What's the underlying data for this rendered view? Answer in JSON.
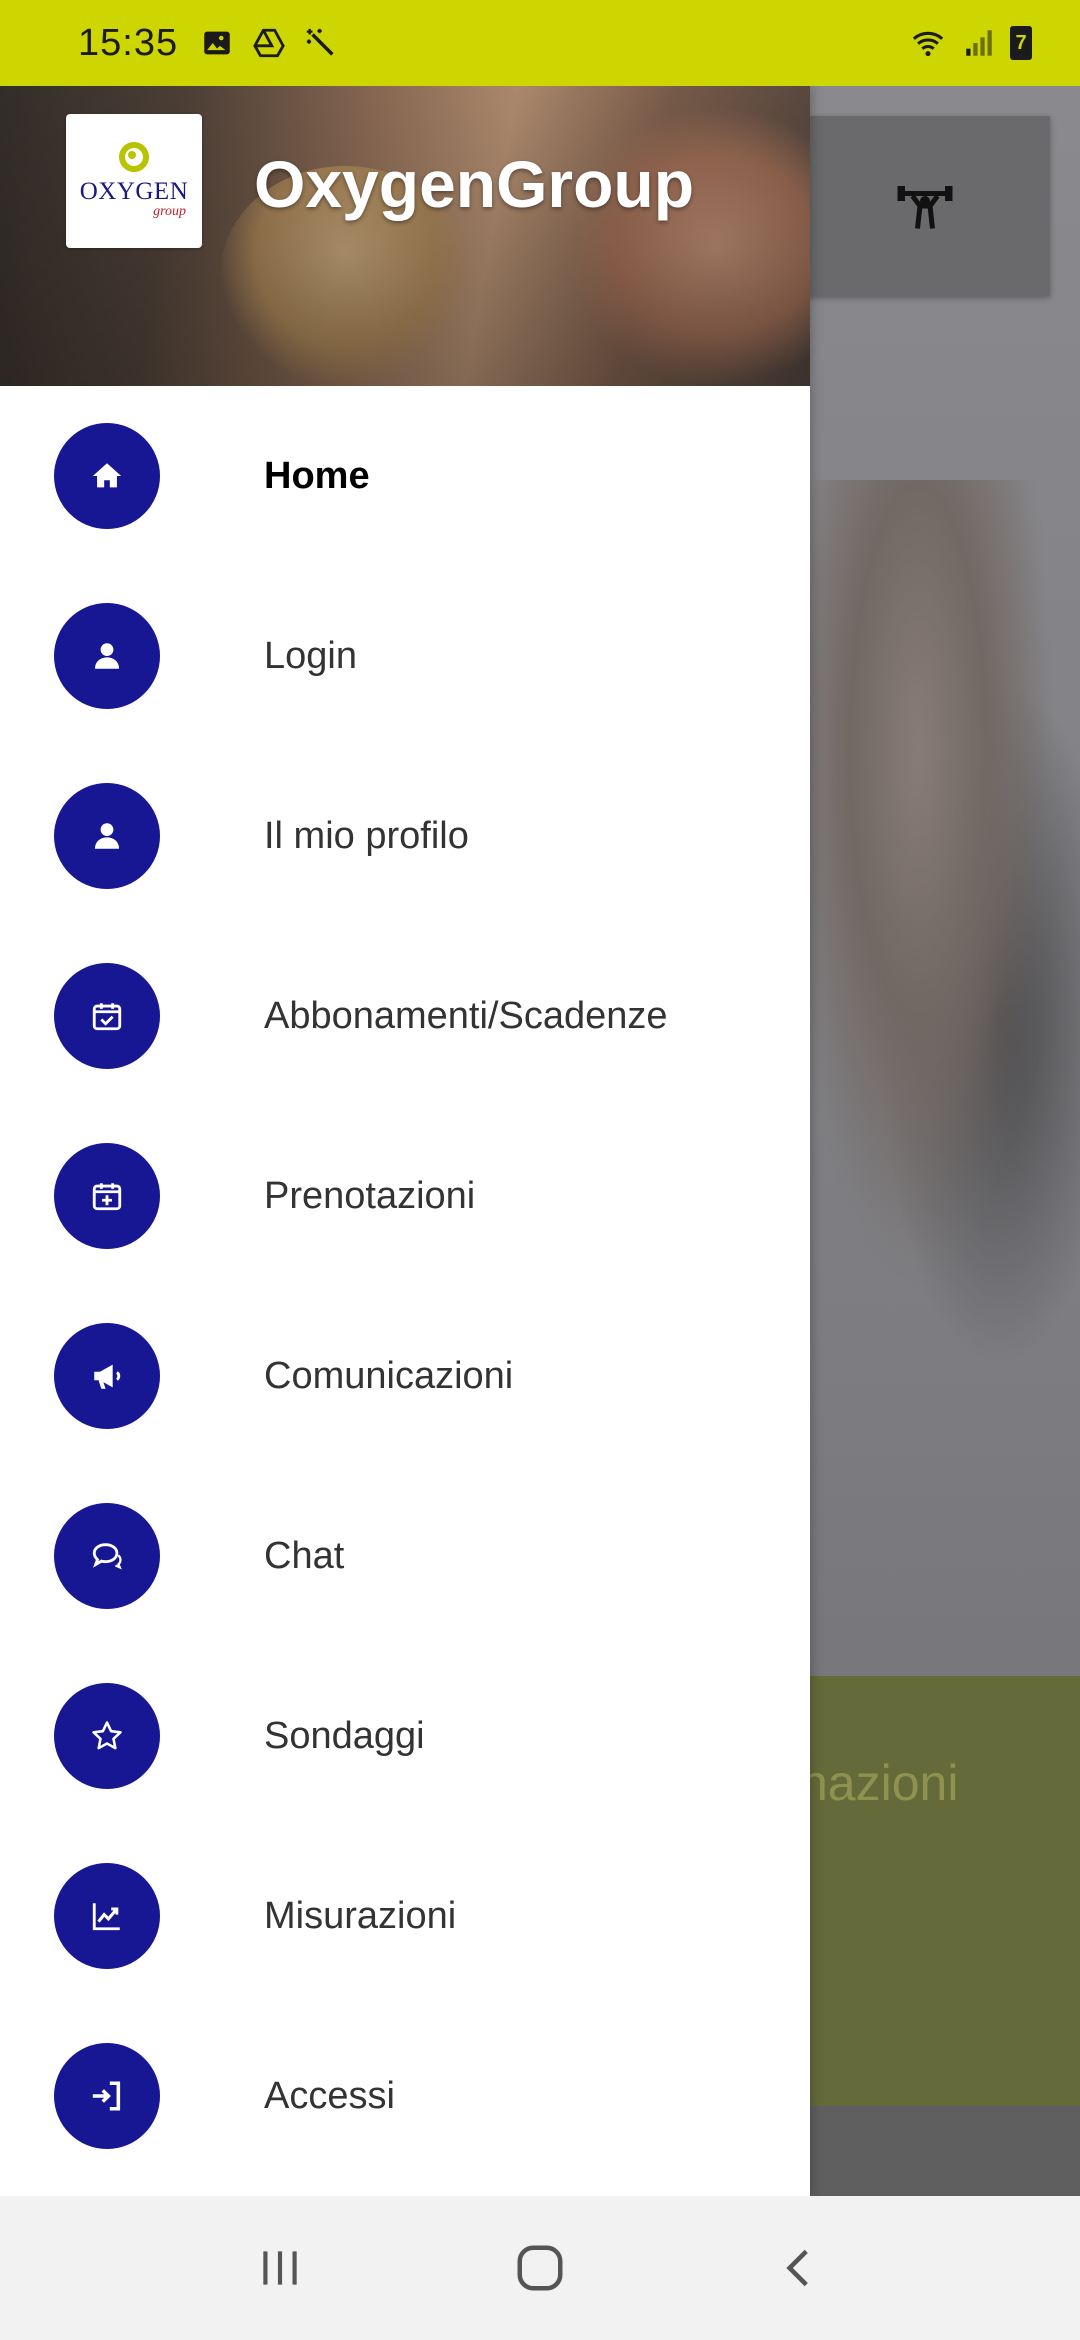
{
  "status_bar": {
    "time": "15:35",
    "left_icons": [
      "image-icon",
      "drive-icon",
      "magic-wand-icon"
    ],
    "right_icons": [
      "wifi-icon",
      "signal-icon",
      "battery-icon"
    ],
    "battery_level": "7"
  },
  "drawer": {
    "brand_title": "OxygenGroup",
    "logo": {
      "word": "OXYGEN",
      "sub": "group"
    },
    "items": [
      {
        "label": "Home",
        "icon": "home-icon",
        "active": true
      },
      {
        "label": "Login",
        "icon": "user-icon",
        "active": false
      },
      {
        "label": "Il mio profilo",
        "icon": "user-icon",
        "active": false
      },
      {
        "label": "Abbonamenti/Scadenze",
        "icon": "calendar-check-icon",
        "active": false
      },
      {
        "label": "Prenotazioni",
        "icon": "calendar-plus-icon",
        "active": false
      },
      {
        "label": "Comunicazioni",
        "icon": "megaphone-icon",
        "active": false
      },
      {
        "label": "Chat",
        "icon": "chat-icon",
        "active": false
      },
      {
        "label": "Sondaggi",
        "icon": "star-icon",
        "active": false
      },
      {
        "label": "Misurazioni",
        "icon": "chart-line-icon",
        "active": false
      },
      {
        "label": "Accessi",
        "icon": "sign-in-icon",
        "active": false
      }
    ]
  },
  "background": {
    "header_icon": "weightlifter-icon",
    "green_card_text": "nazioni"
  },
  "nav_bar": {
    "buttons": [
      "recents-icon",
      "home-circle-icon",
      "back-icon"
    ]
  },
  "colors": {
    "status_bar": "#cdd600",
    "menu_icon_bg": "#171794",
    "drawer_bg": "#ffffff",
    "nav_bar": "#f2f2f2"
  }
}
